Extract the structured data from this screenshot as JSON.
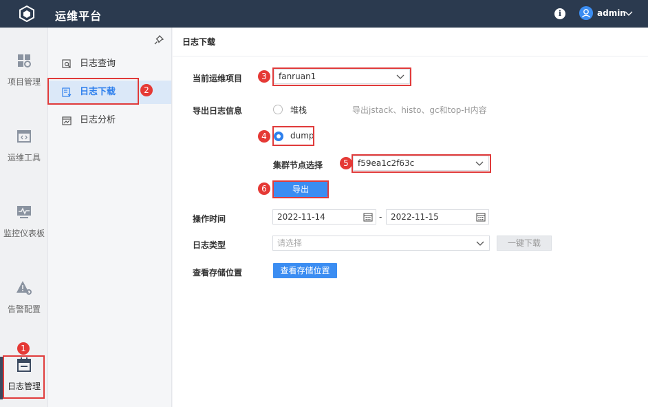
{
  "app": {
    "title": "运维平台"
  },
  "user": {
    "name": "admin",
    "info_glyph": "i"
  },
  "rail": {
    "items": [
      {
        "label": "项目管理",
        "icon": "dashboard-grid-icon"
      },
      {
        "label": "运维工具",
        "icon": "code-window-icon"
      },
      {
        "label": "监控仪表板",
        "icon": "monitor-pulse-icon"
      },
      {
        "label": "告警配置",
        "icon": "alert-gear-icon"
      },
      {
        "label": "日志管理",
        "icon": "log-calendar-icon"
      }
    ]
  },
  "subnav": {
    "items": [
      {
        "label": "日志查询",
        "icon": "search-doc-icon"
      },
      {
        "label": "日志下载",
        "icon": "download-doc-icon"
      },
      {
        "label": "日志分析",
        "icon": "chart-doc-icon"
      }
    ]
  },
  "main": {
    "header": "日志下载",
    "form": {
      "project_label": "当前运维项目",
      "project_value": "fanruan1",
      "export_label": "导出日志信息",
      "radio_stack": "堆栈",
      "stack_hint": "导出jstack、histo、gc和top-H内容",
      "radio_dump": "dump",
      "node_label": "集群节点选择",
      "node_value": "f59ea1c2f63c",
      "export_button": "导出",
      "time_label": "操作时间",
      "date_from": "2022-11-14",
      "date_sep": "-",
      "date_to": "2022-11-15",
      "type_label": "日志类型",
      "type_placeholder": "请选择",
      "oneclick_button": "一键下载",
      "storage_label": "查看存储位置",
      "storage_button": "查看存储位置"
    }
  },
  "annotations": [
    "1",
    "2",
    "3",
    "4",
    "5",
    "6"
  ],
  "colors": {
    "topbar": "#2b3a4f",
    "primary": "#3b8df2",
    "annotation": "#e03a3a"
  }
}
